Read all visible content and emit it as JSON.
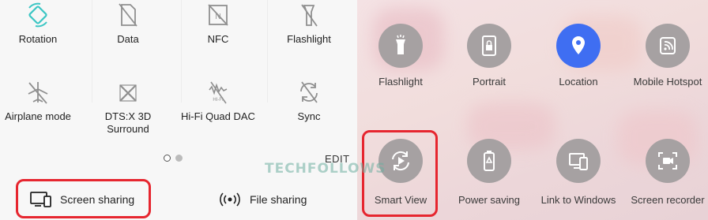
{
  "left_panel": {
    "tiles": [
      {
        "label": "Rotation",
        "icon": "rotation-icon"
      },
      {
        "label": "Data",
        "icon": "data-icon"
      },
      {
        "label": "NFC",
        "icon": "nfc-icon"
      },
      {
        "label": "Flashlight",
        "icon": "flashlight-icon"
      },
      {
        "label": "Airplane mode",
        "icon": "airplane-icon"
      },
      {
        "label": "DTS:X 3D Surround",
        "icon": "dtsx-icon"
      },
      {
        "label": "Hi-Fi Quad DAC",
        "icon": "hifi-dac-icon"
      },
      {
        "label": "Sync",
        "icon": "sync-icon"
      }
    ],
    "edit_label": "EDIT",
    "screen_sharing_label": "Screen sharing",
    "file_sharing_label": "File sharing",
    "page_indicator": {
      "current": 1,
      "total": 2
    }
  },
  "right_panel": {
    "tiles": [
      {
        "label": "Flashlight",
        "icon": "flashlight-icon",
        "active": false
      },
      {
        "label": "Portrait",
        "icon": "portrait-lock-icon",
        "active": false
      },
      {
        "label": "Location",
        "icon": "location-pin-icon",
        "active": true
      },
      {
        "label": "Mobile Hotspot",
        "icon": "hotspot-icon",
        "active": false
      },
      {
        "label": "Smart View",
        "icon": "smart-view-icon",
        "active": false
      },
      {
        "label": "Power saving",
        "icon": "battery-icon",
        "active": false
      },
      {
        "label": "Link to Windows",
        "icon": "link-windows-icon",
        "active": false
      },
      {
        "label": "Screen recorder",
        "icon": "screen-recorder-icon",
        "active": false
      }
    ]
  },
  "watermark": "TECHFOLLOWS",
  "colors": {
    "highlight": "#e6262f",
    "active": "#3f6ef2",
    "icon_circle": "#a6a1a2",
    "icon_stroke": "#8f8f8f"
  }
}
